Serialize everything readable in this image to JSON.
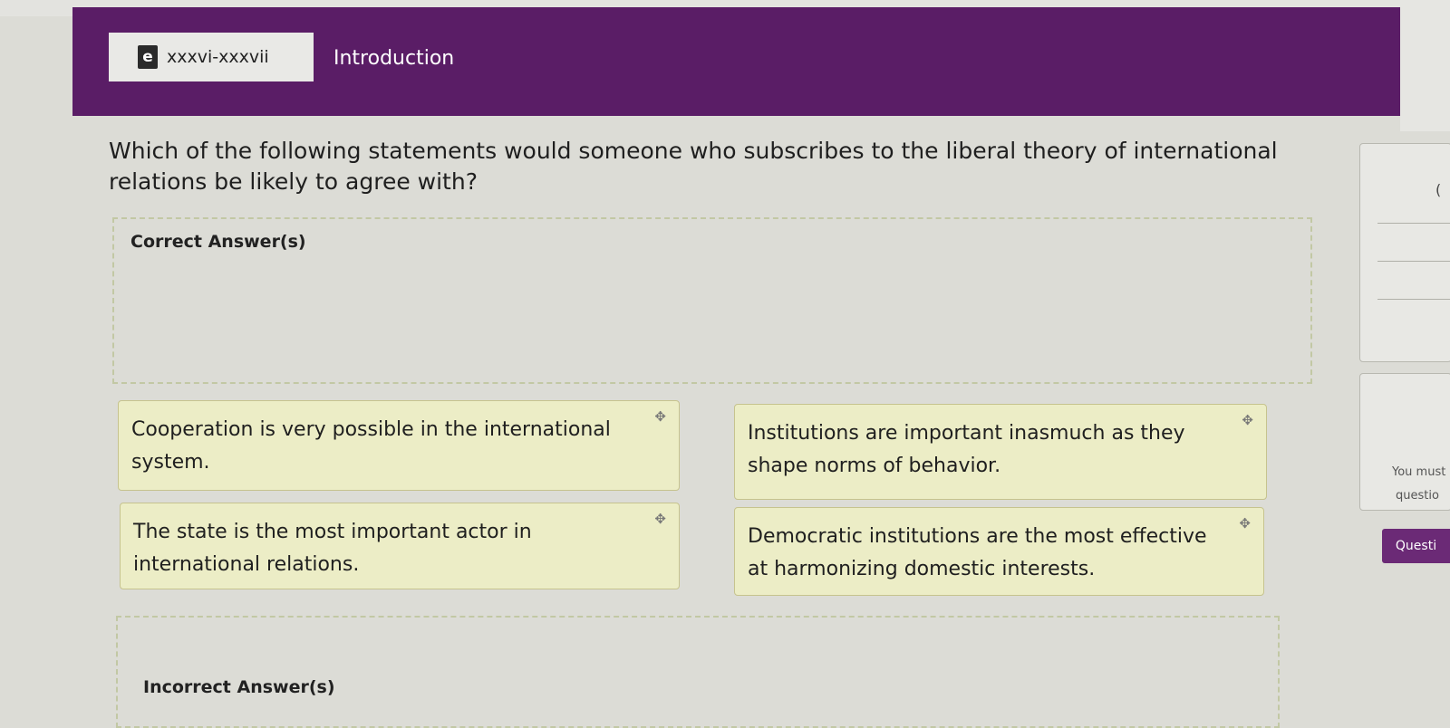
{
  "header": {
    "chip_icon": "e",
    "chip_text": "xxxvi-xxxvii",
    "title": "Introduction"
  },
  "question": {
    "text": "Which of the following statements would someone who subscribes to the liberal theory of international relations be likely to agree with?"
  },
  "zones": {
    "correct_label": "Correct Answer(s)",
    "incorrect_label": "Incorrect Answer(s)"
  },
  "cards": [
    {
      "text": "Cooperation is very possible in the international system.",
      "handle": "✥"
    },
    {
      "text": "Institutions are important inasmuch as they shape norms of behavior.",
      "handle": "✥"
    },
    {
      "text": "The state is the most important actor in international relations.",
      "handle": "✥"
    },
    {
      "text": "Democratic institutions are the most effective at harmonizing domestic interests.",
      "handle": "✥"
    }
  ],
  "side_panel": {
    "bracket": "(",
    "note_line1": "You must",
    "note_line2": "questio",
    "button_label": "Questi"
  },
  "icons": {
    "chip_icon": "ebook-icon",
    "drag_handle": "drag-handle-icon"
  },
  "colors": {
    "header_bg": "#5a1d66",
    "card_bg": "#ecedc6",
    "zone_border": "#c2c8a4"
  }
}
